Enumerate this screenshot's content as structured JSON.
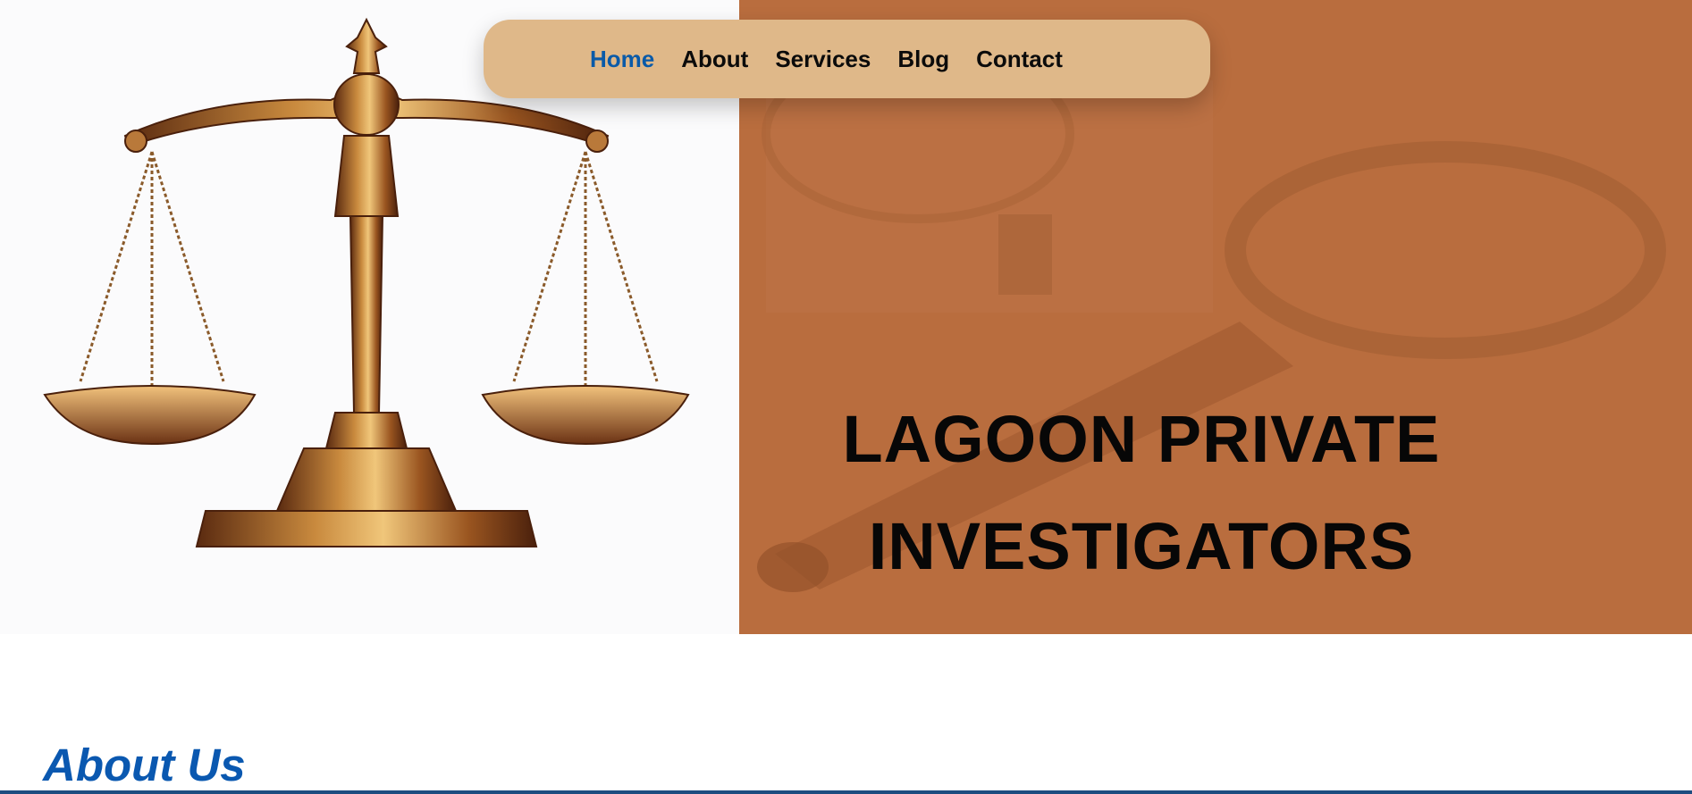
{
  "nav": {
    "items": [
      {
        "label": "Home",
        "active": true
      },
      {
        "label": "About",
        "active": false
      },
      {
        "label": "Services",
        "active": false
      },
      {
        "label": "Blog",
        "active": false
      },
      {
        "label": "Contact",
        "active": false
      }
    ]
  },
  "hero": {
    "title_line1": "LAGOON PRIVATE",
    "title_line2": "INVESTIGATORS",
    "image_left": "scales-of-justice",
    "image_right_background": "magnifying-glass"
  },
  "about": {
    "heading": "About Us"
  },
  "colors": {
    "nav_bg": "#dfb889",
    "nav_active": "#0a5aa8",
    "hero_right_bg": "#b96d3e",
    "heading_blue": "#0a58b0"
  }
}
